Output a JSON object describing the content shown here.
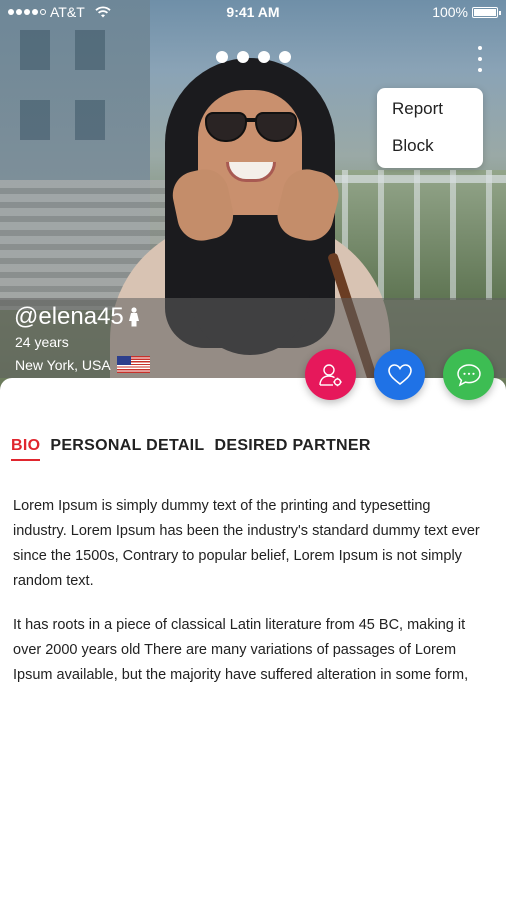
{
  "status_bar": {
    "carrier": "AT&T",
    "time": "9:41 AM",
    "battery_text": "100%",
    "battery_level": 1.0,
    "signal_bars": 5,
    "signal_filled": 4
  },
  "gallery": {
    "page_count": 4,
    "menu_icon": "more-vertical-icon"
  },
  "menu": {
    "items": [
      "Report",
      "Block"
    ]
  },
  "profile": {
    "username": "@elena45",
    "gender_icon": "female-icon",
    "age": "24 years",
    "location": "New York, USA",
    "flag": "us-flag-icon"
  },
  "actions": [
    {
      "name": "view-profile",
      "icon": "user-settings-icon",
      "color": "#e6185b"
    },
    {
      "name": "like",
      "icon": "heart-icon",
      "color": "#1f72e6"
    },
    {
      "name": "chat",
      "icon": "chat-bubble-icon",
      "color": "#3dbd53"
    }
  ],
  "tabs": [
    {
      "label": "BIO",
      "active": true
    },
    {
      "label": "PERSONAL DETAIL",
      "active": false
    },
    {
      "label": "DESIRED PARTNER",
      "active": false
    }
  ],
  "bio": {
    "paragraph_1": "Lorem Ipsum is simply dummy text of the printing and typesetting industry. Lorem Ipsum has been the industry's standard dummy text ever since the 1500s, Contrary to popular belief, Lorem Ipsum is not simply random text.",
    "paragraph_2": "It has roots in a piece of classical Latin literature from 45 BC, making it over 2000 years old There are many variations of passages of Lorem Ipsum available, but the majority have suffered alteration in some form,"
  },
  "colors": {
    "accent_red": "#e0262e",
    "profile_pink": "#e6185b",
    "like_blue": "#1f72e6",
    "chat_green": "#3dbd53"
  }
}
